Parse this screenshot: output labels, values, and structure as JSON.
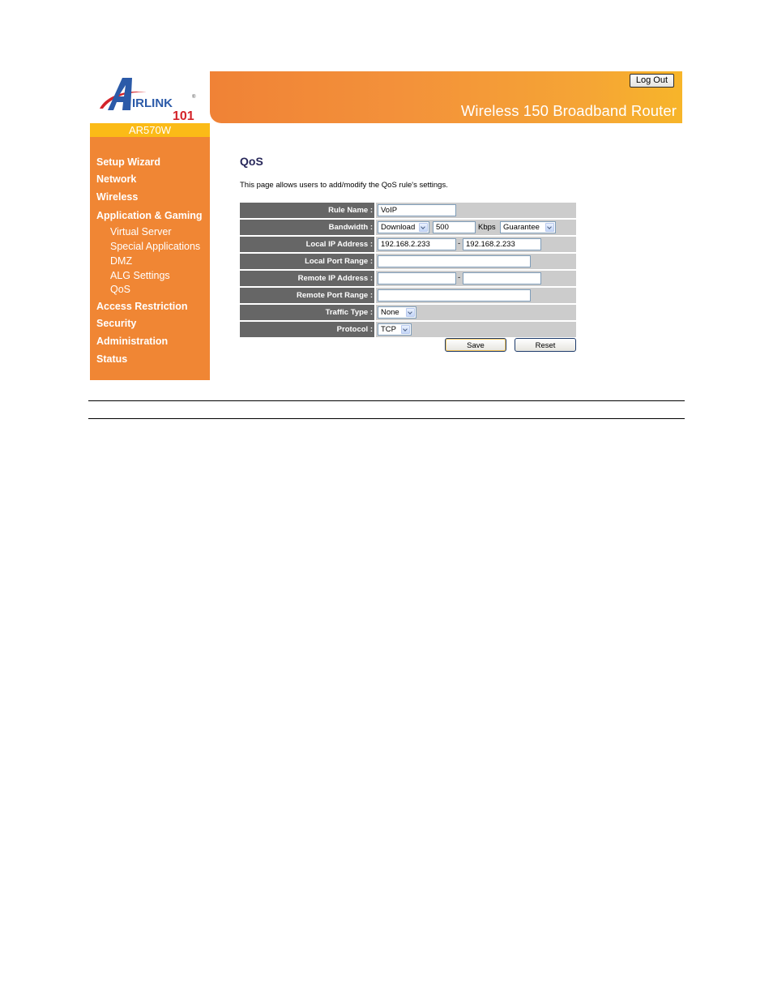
{
  "brand": {
    "logo_text": "AIRLINK",
    "logo_number": "101",
    "model": "AR570W"
  },
  "header": {
    "title": "Wireless 150 Broadband Router",
    "logout_label": "Log Out"
  },
  "sidebar": {
    "items": [
      {
        "label": "Setup Wizard",
        "type": "main"
      },
      {
        "label": "Network",
        "type": "main"
      },
      {
        "label": "Wireless",
        "type": "main"
      },
      {
        "label": "Application & Gaming",
        "type": "main"
      },
      {
        "label": "Virtual Server",
        "type": "sub"
      },
      {
        "label": "Special Applications",
        "type": "sub"
      },
      {
        "label": "DMZ",
        "type": "sub"
      },
      {
        "label": "ALG Settings",
        "type": "sub"
      },
      {
        "label": "QoS",
        "type": "sub"
      },
      {
        "label": "Access Restriction",
        "type": "main"
      },
      {
        "label": "Security",
        "type": "main"
      },
      {
        "label": "Administration",
        "type": "main"
      },
      {
        "label": "Status",
        "type": "main"
      }
    ]
  },
  "main": {
    "title": "QoS",
    "description": "This page allows users to add/modify the QoS rule's settings.",
    "form": {
      "rule_name": {
        "label": "Rule Name :",
        "value": "VoIP"
      },
      "bandwidth": {
        "label": "Bandwidth :",
        "direction": "Download",
        "value": "500",
        "unit": "Kbps",
        "mode": "Guarantee"
      },
      "local_ip": {
        "label": "Local IP Address :",
        "start": "192.168.2.233",
        "separator": "-",
        "end": "192.168.2.233"
      },
      "local_port": {
        "label": "Local Port Range :",
        "value": ""
      },
      "remote_ip": {
        "label": "Remote IP Address :",
        "start": "",
        "separator": "-",
        "end": ""
      },
      "remote_port": {
        "label": "Remote Port Range :",
        "value": ""
      },
      "traffic_type": {
        "label": "Traffic Type :",
        "value": "None"
      },
      "protocol": {
        "label": "Protocol :",
        "value": "TCP"
      }
    },
    "buttons": {
      "save": "Save",
      "reset": "Reset"
    }
  },
  "colors": {
    "sidebar": "#f08634",
    "model_bar": "#fbbb17",
    "label_bg": "#666666",
    "cell_bg": "#cccccc",
    "title": "#27275a"
  }
}
